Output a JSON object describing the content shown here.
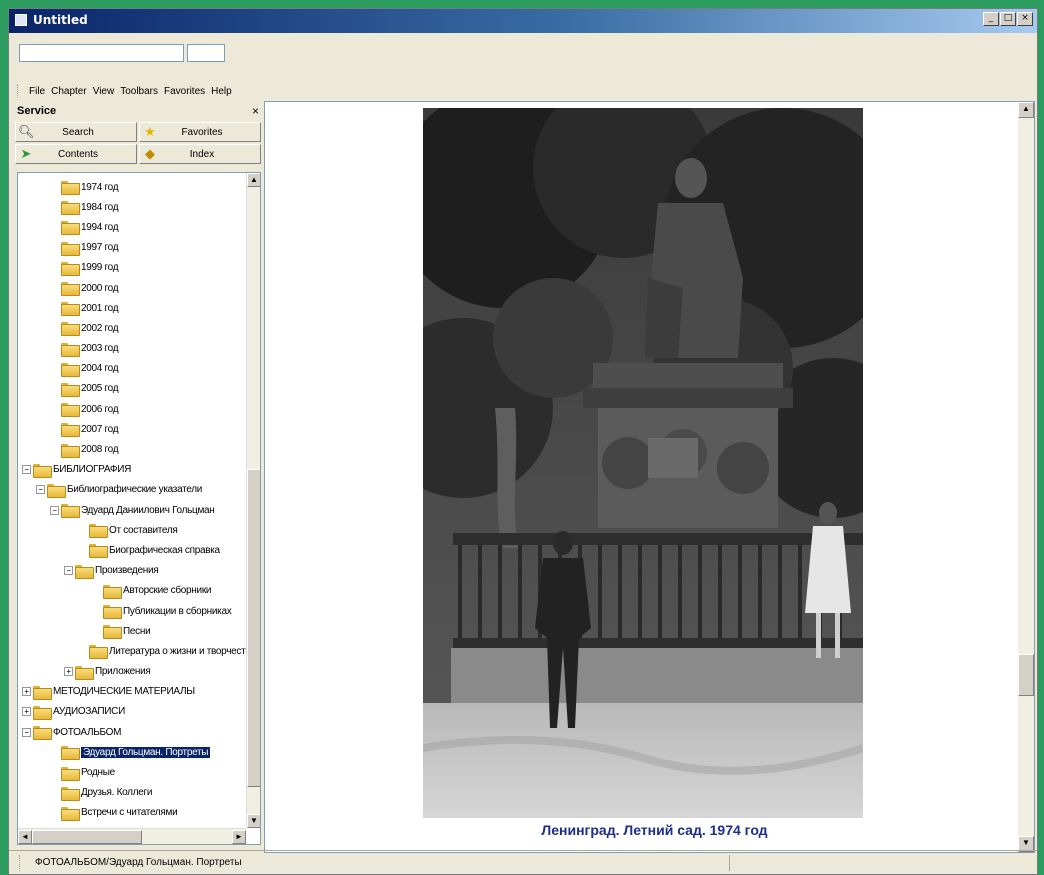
{
  "window": {
    "title": "Untitled",
    "controls": {
      "minimize": "_",
      "maximize": "□",
      "close": "×"
    }
  },
  "toolbar": {
    "address_value": "",
    "combo_value": ""
  },
  "menu": {
    "items": [
      "File",
      "Chapter",
      "View",
      "Toolbars",
      "Favorites",
      "Help"
    ]
  },
  "service": {
    "title": "Service",
    "close": "×",
    "tabs": [
      {
        "label": "Search",
        "icon": "magnifier-icon"
      },
      {
        "label": "Favorites",
        "icon": "star-icon"
      },
      {
        "label": "Contents",
        "icon": "arrow-icon"
      },
      {
        "label": "Index",
        "icon": "key-icon"
      }
    ]
  },
  "tree": {
    "items": [
      {
        "label": "1974 год",
        "level": 2,
        "expander": ""
      },
      {
        "label": "1984 год",
        "level": 2,
        "expander": ""
      },
      {
        "label": "1994 год",
        "level": 2,
        "expander": ""
      },
      {
        "label": "1997 год",
        "level": 2,
        "expander": ""
      },
      {
        "label": "1999 год",
        "level": 2,
        "expander": ""
      },
      {
        "label": "2000 год",
        "level": 2,
        "expander": ""
      },
      {
        "label": "2001 год",
        "level": 2,
        "expander": ""
      },
      {
        "label": "2002 год",
        "level": 2,
        "expander": ""
      },
      {
        "label": "2003 год",
        "level": 2,
        "expander": ""
      },
      {
        "label": "2004 год",
        "level": 2,
        "expander": ""
      },
      {
        "label": "2005 год",
        "level": 2,
        "expander": ""
      },
      {
        "label": "2006 год",
        "level": 2,
        "expander": ""
      },
      {
        "label": "2007 год",
        "level": 2,
        "expander": ""
      },
      {
        "label": "2008 год",
        "level": 2,
        "expander": ""
      },
      {
        "label": "БИБЛИОГРАФИЯ",
        "level": 0,
        "expander": "−"
      },
      {
        "label": "Библиографические указатели",
        "level": 1,
        "expander": "−"
      },
      {
        "label": "Эдуард Даниилович Гольцман",
        "level": 2,
        "expander": "−"
      },
      {
        "label": "От составителя",
        "level": 4,
        "expander": ""
      },
      {
        "label": "Биографическая справка",
        "level": 4,
        "expander": ""
      },
      {
        "label": "Произведения",
        "level": 3,
        "expander": "−"
      },
      {
        "label": "Авторские сборники",
        "level": 5,
        "expander": ""
      },
      {
        "label": "Публикации в сборниках",
        "level": 5,
        "expander": ""
      },
      {
        "label": "Песни",
        "level": 5,
        "expander": ""
      },
      {
        "label": "Литература о жизни и творчестве",
        "level": 4,
        "expander": ""
      },
      {
        "label": "Приложения",
        "level": 3,
        "expander": "+"
      },
      {
        "label": "МЕТОДИЧЕСКИЕ МАТЕРИАЛЫ",
        "level": 0,
        "expander": "+"
      },
      {
        "label": "АУДИОЗАПИСИ",
        "level": 0,
        "expander": "+"
      },
      {
        "label": "ФОТОАЛЬБОМ",
        "level": 0,
        "expander": "−"
      },
      {
        "label": "Эдуард Гольцман. Портреты",
        "level": 2,
        "expander": "",
        "selected": true
      },
      {
        "label": "Родные",
        "level": 2,
        "expander": ""
      },
      {
        "label": "Друзья. Коллеги",
        "level": 2,
        "expander": ""
      },
      {
        "label": "Встречи с читателями",
        "level": 2,
        "expander": ""
      }
    ]
  },
  "content": {
    "caption": "Ленинград. Летний сад. 1974 год"
  },
  "status": {
    "path": "ФОТОАЛЬБОМ/Эдуард Гольцман. Портреты"
  },
  "colors": {
    "selection": "#0a246a",
    "caption": "#1c2d8a",
    "desktop": "#2c9b5e"
  }
}
